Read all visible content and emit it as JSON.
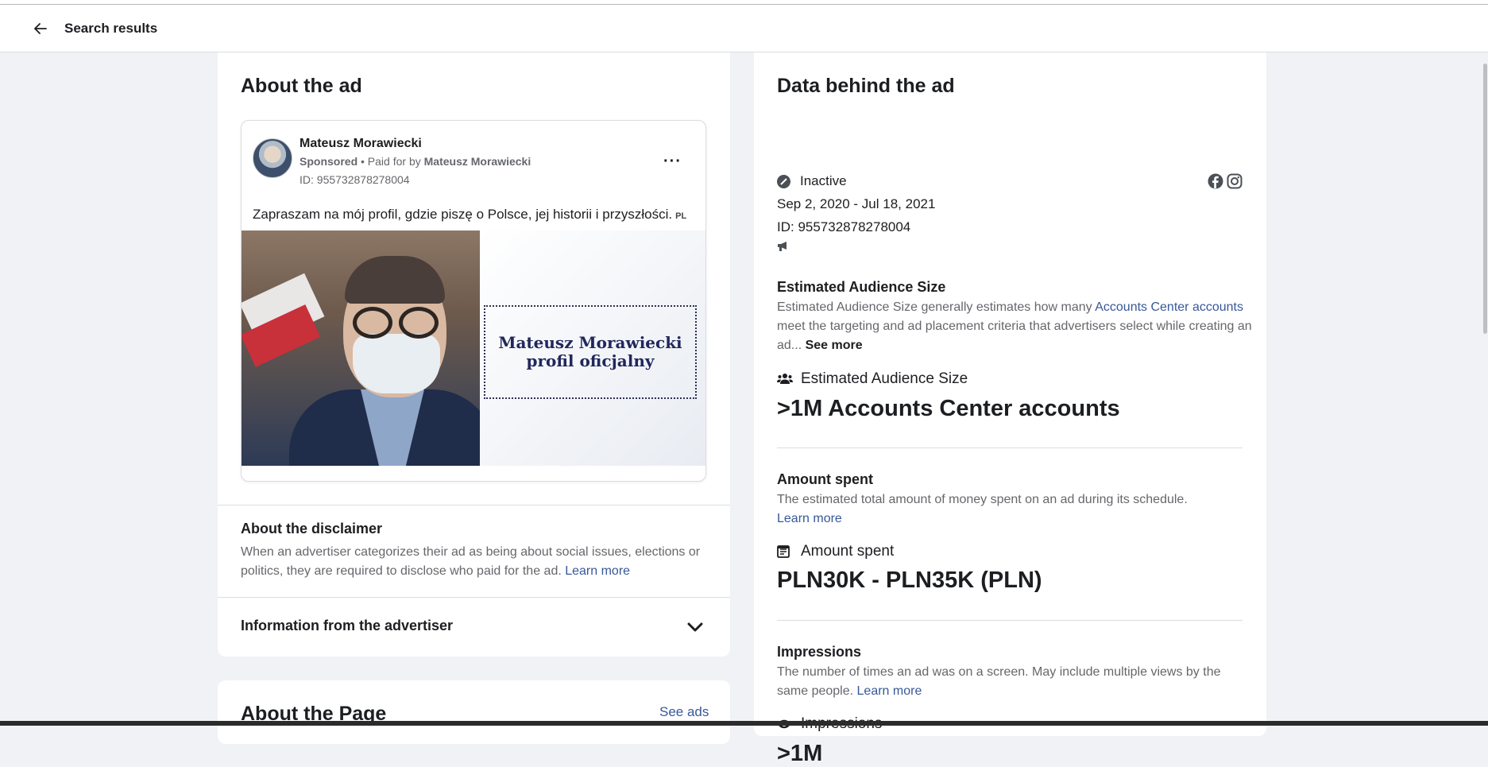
{
  "header": {
    "back_icon": "arrow-left-icon",
    "title": "Search results"
  },
  "about_ad": {
    "title": "About the ad",
    "advertiser_name": "Mateusz Morawiecki",
    "sponsored_label": "Sponsored",
    "paid_for_by_label": " • Paid for by ",
    "paid_for_by_name": "Mateusz Morawiecki",
    "ad_id": "ID: 955732878278004",
    "more_icon": "more-dots-icon",
    "more_label": "···",
    "ad_text": "Zapraszam na mój profil, gdzie piszę o Polsce, jej historii i przyszłości.",
    "lang_tag": "PL",
    "banner_line1": "Mateusz Morawiecki",
    "banner_line2": "profil oficjalny"
  },
  "disclaimer": {
    "title": "About the disclaimer",
    "text": "When an advertiser categorizes their ad as being about social issues, elections or politics, they are required to disclose who paid for the ad.",
    "link": "Learn more"
  },
  "advertiser_info": {
    "title": "Information from the advertiser",
    "chevron_icon": "chevron-down-icon"
  },
  "about_page": {
    "title": "About the Page",
    "see_ads": "See ads"
  },
  "data_behind": {
    "title": "Data behind the ad",
    "status": "Inactive",
    "status_icon": "inactive-icon",
    "platforms": [
      "facebook-icon",
      "instagram-icon"
    ],
    "date_range": "Sep 2, 2020 - Jul 18, 2021",
    "ad_id": "ID: 955732878278004",
    "megaphone_icon": "megaphone-icon"
  },
  "audience": {
    "title": "Estimated Audience Size",
    "desc_before": "Estimated Audience Size generally estimates how many ",
    "desc_link": "Accounts Center accounts",
    "desc_after": " meet the targeting and ad placement criteria that advertisers select while creating an ad...",
    "see_more": "See more",
    "metric_label": "Estimated Audience Size",
    "metric_icon": "people-icon",
    "value": ">1M Accounts Center accounts"
  },
  "amount": {
    "title": "Amount spent",
    "desc": "The estimated total amount of money spent on an ad during its schedule.",
    "link": "Learn more",
    "metric_label": "Amount spent",
    "metric_icon": "receipt-icon",
    "value": "PLN30K - PLN35K (PLN)"
  },
  "impressions": {
    "title": "Impressions",
    "desc": "The number of times an ad was on a screen. May include multiple views by the same people.",
    "link": "Learn more",
    "metric_label": "Impressions",
    "metric_icon": "eye-icon",
    "value": ">1M"
  }
}
